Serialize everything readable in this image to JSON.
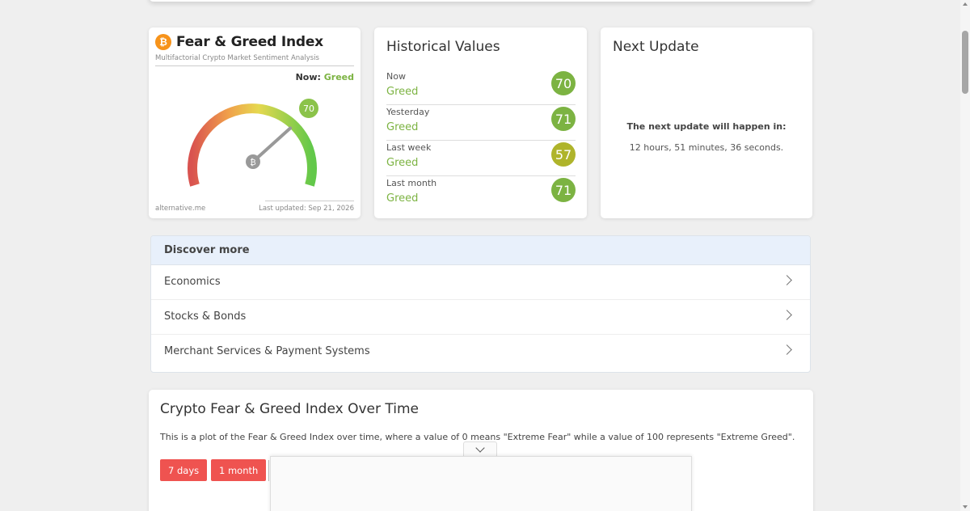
{
  "fear_greed": {
    "logo_glyph": "₿",
    "title": "Fear & Greed Index",
    "subtitle": "Multifactorial Crypto Market Sentiment Analysis",
    "now_label": "Now:",
    "now_value": "Greed",
    "gauge_value": 70,
    "gauge_value_text": "70",
    "gauge_center_glyph": "₿",
    "footer_left": "alternative.me",
    "footer_right": "Last updated: Sep 21, 2026"
  },
  "historical": {
    "title": "Historical Values",
    "rows": [
      {
        "label": "Now",
        "classification": "Greed",
        "value": "70",
        "color": "#7cb342"
      },
      {
        "label": "Yesterday",
        "classification": "Greed",
        "value": "71",
        "color": "#7cb342"
      },
      {
        "label": "Last week",
        "classification": "Greed",
        "value": "57",
        "color": "#afb42b"
      },
      {
        "label": "Last month",
        "classification": "Greed",
        "value": "71",
        "color": "#7cb342"
      }
    ]
  },
  "next_update": {
    "title": "Next Update",
    "heading": "The next update will happen in:",
    "time": "12 hours, 51 minutes, 36 seconds."
  },
  "discover": {
    "heading": "Discover more",
    "items": [
      {
        "label": "Economics"
      },
      {
        "label": "Stocks & Bonds"
      },
      {
        "label": "Merchant Services & Payment Systems"
      }
    ]
  },
  "over_time": {
    "title": "Crypto Fear & Greed Index Over Time",
    "description": "This is a plot of the Fear & Greed Index over time, where a value of 0 means \"Extreme Fear\" while a value of 100 represents \"Extreme Greed\".",
    "buttons": [
      {
        "label": "7 days"
      },
      {
        "label": "1 month"
      }
    ]
  },
  "colors": {
    "greed": "#7cb342",
    "neutral_greed": "#afb42b",
    "button_red": "#ef5350",
    "bitcoin_orange": "#f7931a"
  }
}
